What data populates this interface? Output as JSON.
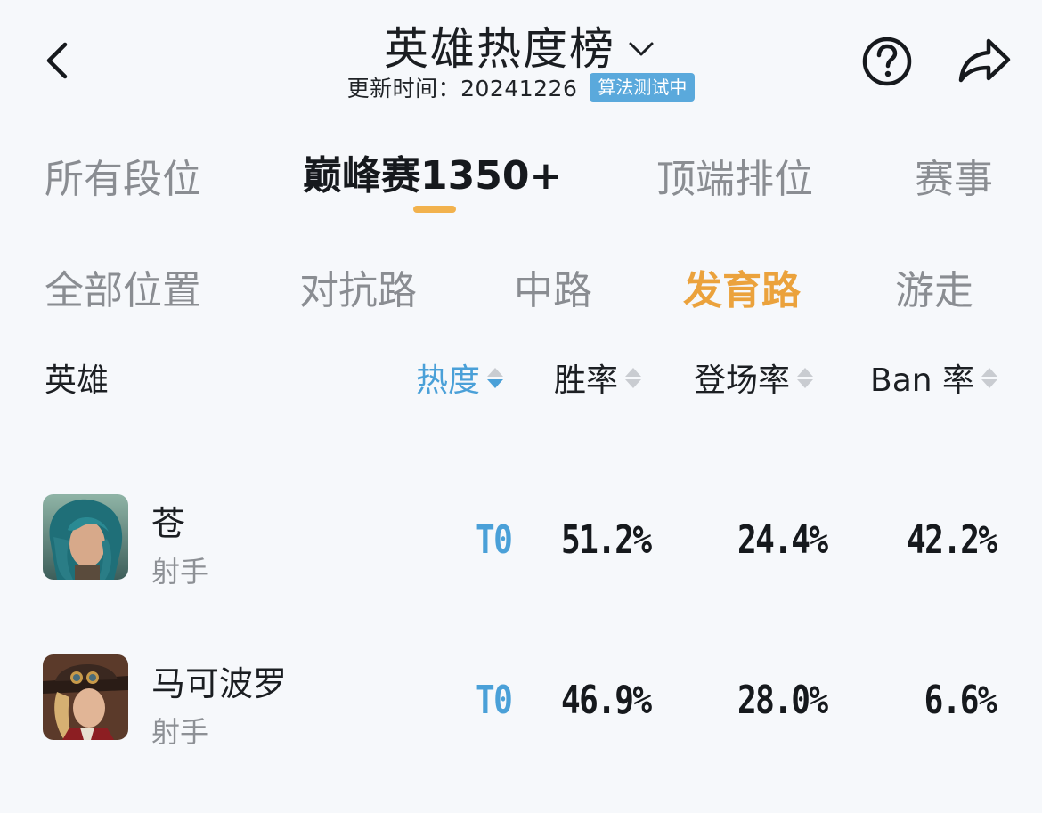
{
  "header": {
    "title": "英雄热度榜",
    "update_text": "更新时间：20241226",
    "algo_badge": "算法测试中"
  },
  "rank_tabs": [
    {
      "label": "所有段位",
      "active": false
    },
    {
      "label": "巅峰赛1350+",
      "active": true
    },
    {
      "label": "顶端排位",
      "active": false
    },
    {
      "label": "赛事",
      "active": false
    }
  ],
  "position_tabs": [
    {
      "label": "全部位置",
      "active": false
    },
    {
      "label": "对抗路",
      "active": false
    },
    {
      "label": "中路",
      "active": false
    },
    {
      "label": "发育路",
      "active": true
    },
    {
      "label": "游走",
      "active": false
    }
  ],
  "columns": {
    "hero": "英雄",
    "heat": "热度",
    "win_rate": "胜率",
    "pick_rate": "登场率",
    "ban_rate": "Ban 率"
  },
  "sort": {
    "column": "heat",
    "direction": "desc"
  },
  "colors": {
    "accent_blue": "#4aa0d8",
    "accent_orange": "#eba23c",
    "underline": "#f2b24d",
    "badge": "#5aa9dc"
  },
  "heroes": [
    {
      "name": "苍",
      "role": "射手",
      "tier": "T0",
      "win_rate": "51.2%",
      "pick_rate": "24.4%",
      "ban_rate": "42.2%"
    },
    {
      "name": "马可波罗",
      "role": "射手",
      "tier": "T0",
      "win_rate": "46.9%",
      "pick_rate": "28.0%",
      "ban_rate": "6.6%"
    }
  ]
}
